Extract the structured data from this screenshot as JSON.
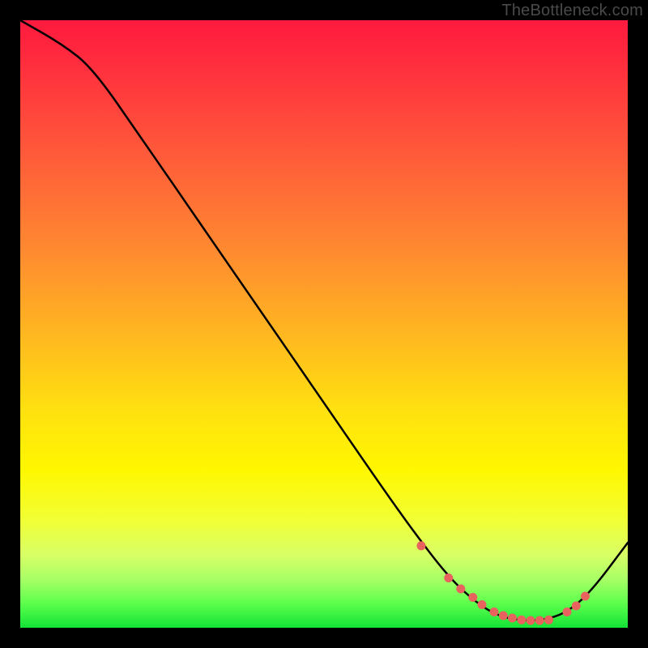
{
  "watermark": "TheBottleneck.com",
  "chart_data": {
    "type": "line",
    "title": "",
    "xlabel": "",
    "ylabel": "",
    "xlim": [
      0,
      100
    ],
    "ylim": [
      0,
      100
    ],
    "series": [
      {
        "name": "curve",
        "x": [
          0,
          7,
          12,
          20,
          30,
          40,
          50,
          60,
          65,
          70,
          74,
          78,
          82,
          86,
          90,
          94,
          100
        ],
        "y": [
          100,
          96,
          92,
          80.5,
          66,
          51.5,
          37,
          22.5,
          15.5,
          9,
          5,
          2.2,
          1.2,
          1.2,
          2.5,
          6,
          14
        ]
      }
    ],
    "markers": {
      "name": "highlight-dots",
      "x": [
        66,
        70.5,
        72.5,
        74.5,
        76,
        78,
        79.5,
        81,
        82.5,
        84,
        85.5,
        87,
        90,
        91.5,
        93
      ],
      "y": [
        13.5,
        8.2,
        6.4,
        5.0,
        3.8,
        2.6,
        2.0,
        1.6,
        1.3,
        1.2,
        1.2,
        1.3,
        2.6,
        3.6,
        5.2
      ]
    },
    "gradient_stops": [
      {
        "pos": 0,
        "color": "#ff1a3e"
      },
      {
        "pos": 22,
        "color": "#ff5a3a"
      },
      {
        "pos": 52,
        "color": "#ffb820"
      },
      {
        "pos": 74,
        "color": "#fff700"
      },
      {
        "pos": 92,
        "color": "#a8ff66"
      },
      {
        "pos": 100,
        "color": "#14e236"
      }
    ]
  }
}
